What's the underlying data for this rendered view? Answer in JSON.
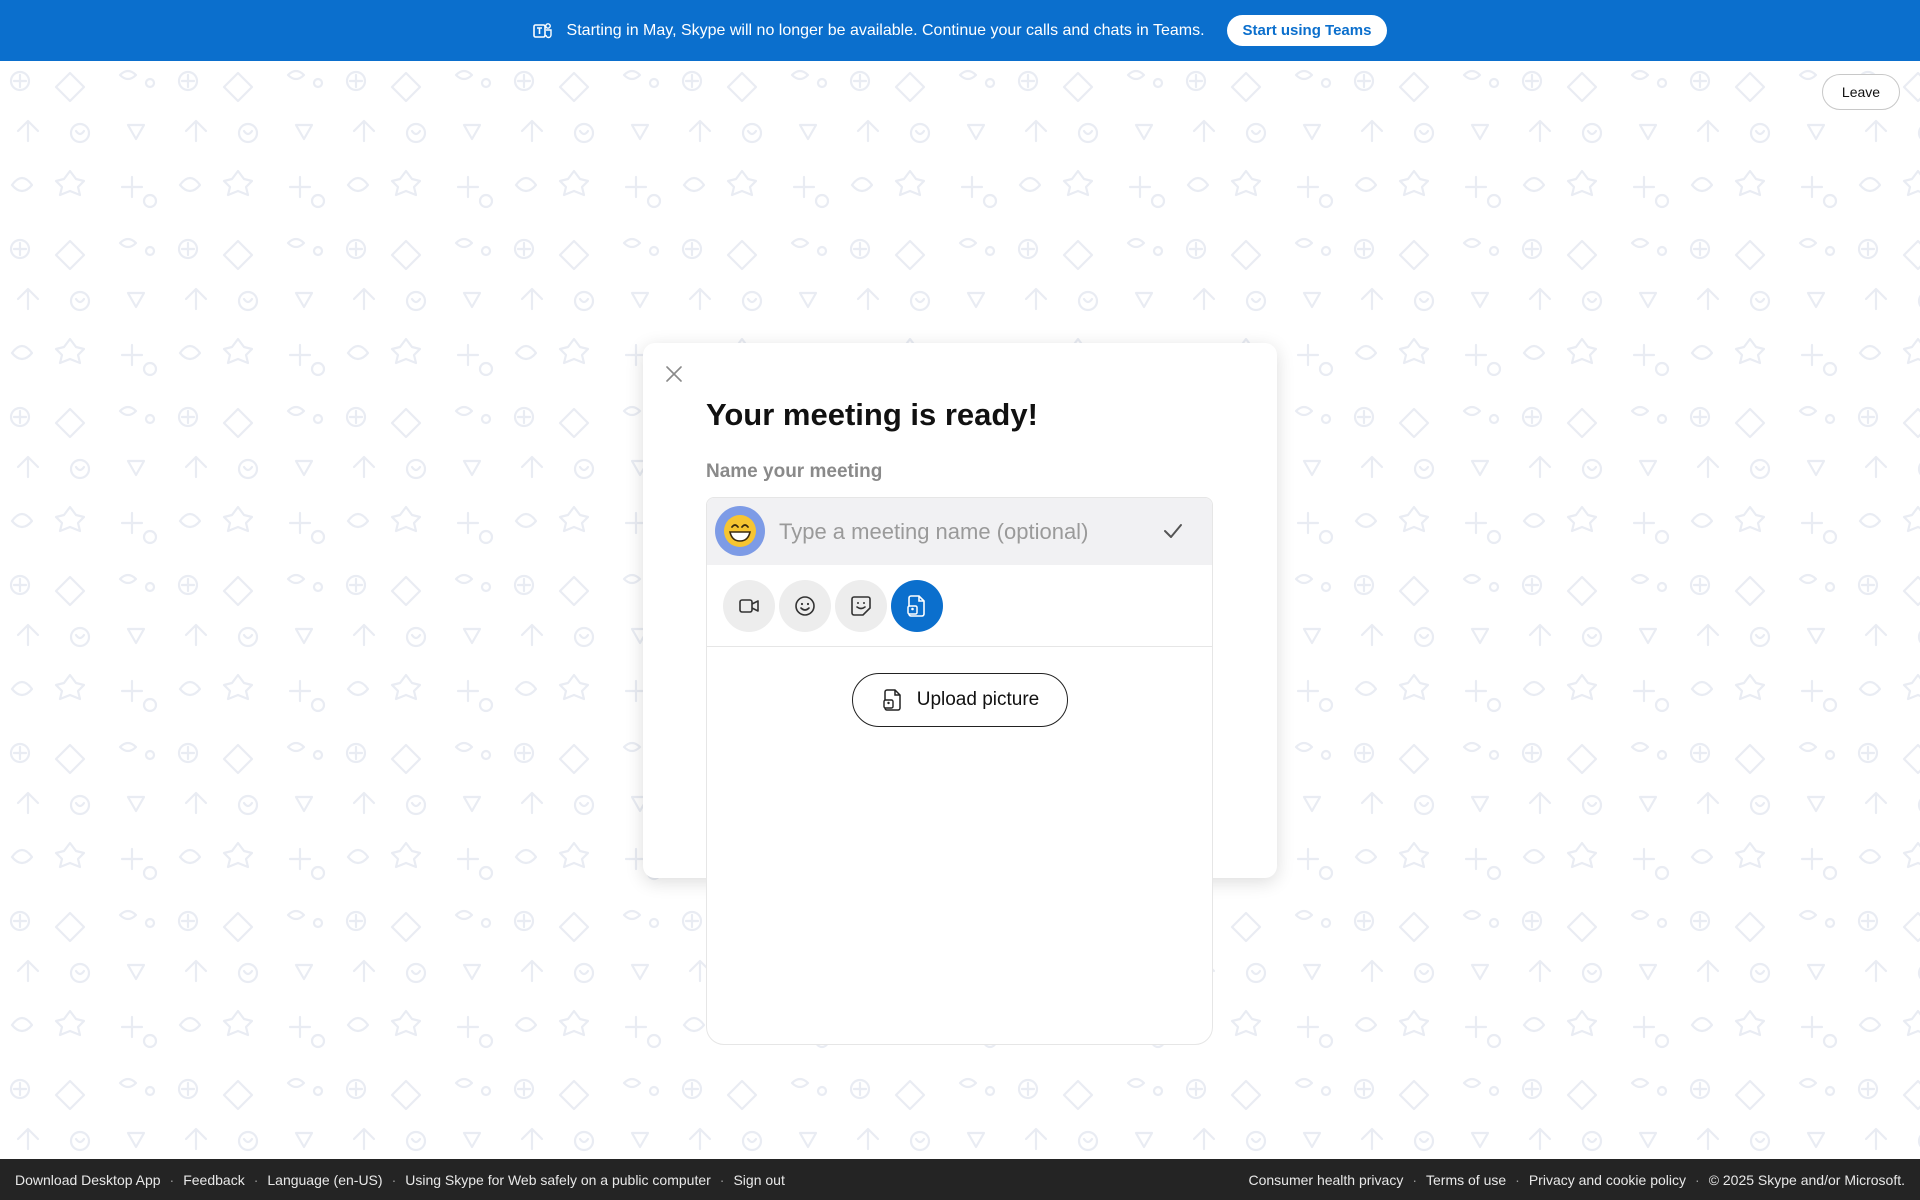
{
  "banner": {
    "icon": "teams-icon",
    "message": "Starting in May, Skype will no longer be available. Continue your calls and chats in Teams.",
    "button_label": "Start using Teams",
    "color": "#0b6fcd"
  },
  "header": {
    "leave_label": "Leave"
  },
  "dialog": {
    "title": "Your meeting is ready!",
    "subtitle": "Name your meeting",
    "name_input": {
      "value": "",
      "placeholder": "Type a meeting name (optional)"
    },
    "avatar_icon": "grinning-emoji-icon",
    "tools": [
      {
        "icon": "video-icon",
        "active": false
      },
      {
        "icon": "emoji-icon",
        "active": false
      },
      {
        "icon": "sticker-icon",
        "active": false
      },
      {
        "icon": "picture-file-icon",
        "active": true
      }
    ],
    "upload_label": "Upload picture"
  },
  "footer": {
    "left_links": [
      "Download Desktop App",
      "Feedback",
      "Language (en-US)",
      "Using Skype for Web safely on a public computer",
      "Sign out"
    ],
    "right_links": [
      "Consumer health privacy",
      "Terms of use",
      "Privacy and cookie policy"
    ],
    "copyright": "© 2025 Skype and/or Microsoft."
  },
  "colors": {
    "accent": "#0b6fcd",
    "footer_bg": "#242424",
    "pattern": "#e9ecf3"
  }
}
